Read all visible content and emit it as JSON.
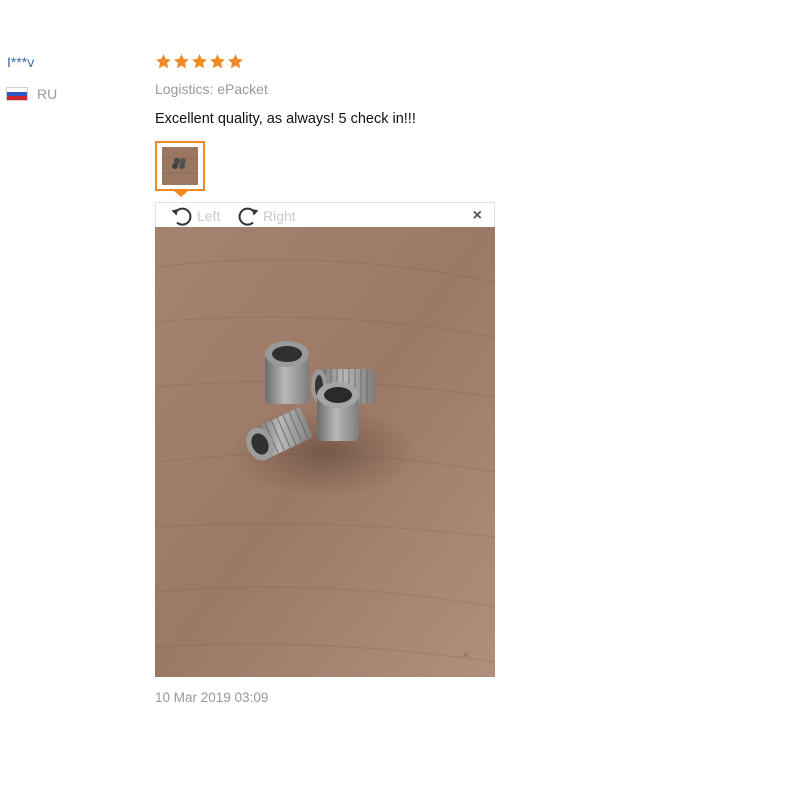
{
  "reviewer": {
    "name": "I***v",
    "country": "RU",
    "flag_colors": [
      "#ffffff",
      "#2d56c6",
      "#d0262b"
    ]
  },
  "review": {
    "rating": 5,
    "star_color": "#f08a24",
    "logistics": "Logistics: ePacket",
    "text": "Excellent quality, as always! 5 check in!!!",
    "date": "10 Mar 2019 03:09"
  },
  "viewer": {
    "rotate_left_label": "Left",
    "rotate_right_label": "Right",
    "close_label": "×",
    "accent": "#f08a24"
  },
  "icons": {
    "star": "star-icon",
    "rotate_left": "rotate-left-icon",
    "rotate_right": "rotate-right-icon",
    "close": "close-icon"
  }
}
